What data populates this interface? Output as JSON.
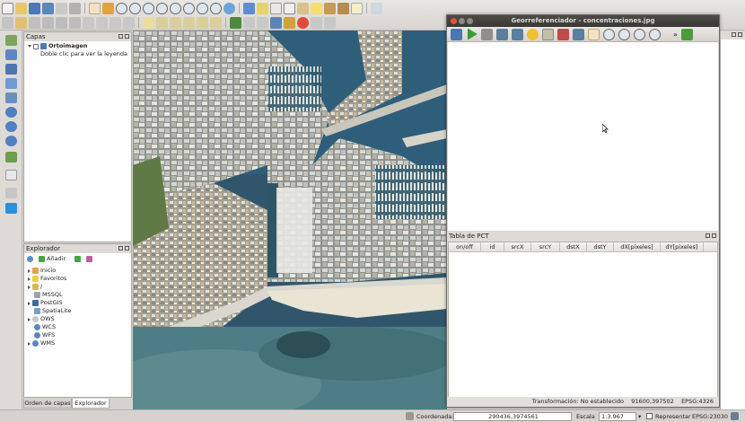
{
  "layers_panel": {
    "title": "Capas",
    "items": [
      {
        "label": "Ortoimagen"
      },
      {
        "label": "Doble clic para ver la leyenda"
      }
    ]
  },
  "browser_panel": {
    "title": "Explorador",
    "add_label": "Añadir",
    "items": [
      {
        "label": "Inicio"
      },
      {
        "label": "Favoritos"
      },
      {
        "label": "/"
      },
      {
        "label": "MSSQL"
      },
      {
        "label": "PostGIS"
      },
      {
        "label": "SpatiaLite"
      },
      {
        "label": "OWS"
      },
      {
        "label": "WCS"
      },
      {
        "label": "WFS"
      },
      {
        "label": "WMS"
      }
    ]
  },
  "bottom_tabs": [
    "Orden de capas",
    "Explorador"
  ],
  "georef": {
    "title": "Georreferenciador - concentraciones.jpg",
    "table_title": "Tabla de PCT",
    "columns": [
      "on/off",
      "id",
      "srcX",
      "srcY",
      "dstX",
      "dstY",
      "dX[pixeles]",
      "dY[pixeles]"
    ],
    "status_transform": "Transformación: No establecido",
    "status_coords": "91600,397502",
    "status_epsg": "EPSG:4326"
  },
  "statusbar": {
    "coord_label": "Coordenada:",
    "coord_value": "290436,3974561",
    "scale_label": "Escala",
    "scale_value": "1:3.967",
    "render_label": "Representar",
    "epsg": "EPSG:23030"
  },
  "colors": {
    "sea": "#4f7d86",
    "water_deep": "#3e6a72",
    "title_bar": "#3a3935",
    "close_btn": "#e0533a"
  }
}
